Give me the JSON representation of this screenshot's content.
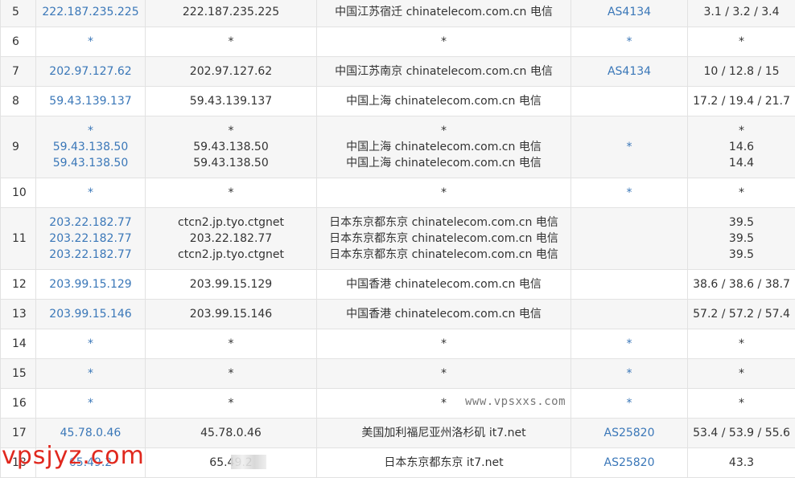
{
  "rows": [
    {
      "hop": "5",
      "ip": [
        "222.187.235.225"
      ],
      "host": [
        "222.187.235.225"
      ],
      "geo": [
        "中国江苏宿迁 chinatelecom.com.cn 电信"
      ],
      "as": [
        "AS4134"
      ],
      "latency": [
        "3.1 / 3.2 / 3.4"
      ]
    },
    {
      "hop": "6",
      "ip": [
        "*"
      ],
      "host": [
        "*"
      ],
      "geo": [
        "*"
      ],
      "as": [
        "*"
      ],
      "latency": [
        "*"
      ]
    },
    {
      "hop": "7",
      "ip": [
        "202.97.127.62"
      ],
      "host": [
        "202.97.127.62"
      ],
      "geo": [
        "中国江苏南京 chinatelecom.com.cn 电信"
      ],
      "as": [
        "AS4134"
      ],
      "latency": [
        "10 / 12.8 / 15"
      ]
    },
    {
      "hop": "8",
      "ip": [
        "59.43.139.137"
      ],
      "host": [
        "59.43.139.137"
      ],
      "geo": [
        "中国上海 chinatelecom.com.cn 电信"
      ],
      "as": [
        ""
      ],
      "latency": [
        "17.2 / 19.4 / 21.7"
      ]
    },
    {
      "hop": "9",
      "ip": [
        "*",
        "59.43.138.50",
        "59.43.138.50"
      ],
      "host": [
        "*",
        "59.43.138.50",
        "59.43.138.50"
      ],
      "geo": [
        "*",
        "中国上海 chinatelecom.com.cn 电信",
        "中国上海 chinatelecom.com.cn 电信"
      ],
      "as": [
        "*",
        "",
        ""
      ],
      "latency": [
        "*",
        "14.6",
        "14.4"
      ]
    },
    {
      "hop": "10",
      "ip": [
        "*"
      ],
      "host": [
        "*"
      ],
      "geo": [
        "*"
      ],
      "as": [
        "*"
      ],
      "latency": [
        "*"
      ]
    },
    {
      "hop": "11",
      "ip": [
        "203.22.182.77",
        "203.22.182.77",
        "203.22.182.77"
      ],
      "host": [
        "ctcn2.jp.tyo.ctgnet",
        "203.22.182.77",
        "ctcn2.jp.tyo.ctgnet"
      ],
      "geo": [
        "日本东京都东京 chinatelecom.com.cn 电信",
        "日本东京都东京 chinatelecom.com.cn 电信",
        "日本东京都东京 chinatelecom.com.cn 电信"
      ],
      "as": [
        "",
        "",
        ""
      ],
      "latency": [
        "39.5",
        "39.5",
        "39.5"
      ]
    },
    {
      "hop": "12",
      "ip": [
        "203.99.15.129"
      ],
      "host": [
        "203.99.15.129"
      ],
      "geo": [
        "中国香港 chinatelecom.com.cn 电信"
      ],
      "as": [
        ""
      ],
      "latency": [
        "38.6 / 38.6 / 38.7"
      ]
    },
    {
      "hop": "13",
      "ip": [
        "203.99.15.146"
      ],
      "host": [
        "203.99.15.146"
      ],
      "geo": [
        "中国香港 chinatelecom.com.cn 电信"
      ],
      "as": [
        ""
      ],
      "latency": [
        "57.2 / 57.2 / 57.4"
      ]
    },
    {
      "hop": "14",
      "ip": [
        "*"
      ],
      "host": [
        "*"
      ],
      "geo": [
        "*"
      ],
      "as": [
        "*"
      ],
      "latency": [
        "*"
      ]
    },
    {
      "hop": "15",
      "ip": [
        "*"
      ],
      "host": [
        "*"
      ],
      "geo": [
        "*"
      ],
      "as": [
        "*"
      ],
      "latency": [
        "*"
      ]
    },
    {
      "hop": "16",
      "ip": [
        "*"
      ],
      "host": [
        "*"
      ],
      "geo": [
        "*"
      ],
      "as": [
        "*"
      ],
      "latency": [
        "*"
      ]
    },
    {
      "hop": "17",
      "ip": [
        "45.78.0.46"
      ],
      "host": [
        "45.78.0.46"
      ],
      "geo": [
        "美国加利福尼亚州洛杉矶 it7.net"
      ],
      "as": [
        "AS25820"
      ],
      "latency": [
        "53.4 / 53.9 / 55.6"
      ]
    },
    {
      "hop": "18",
      "ip": [
        "65.49.2"
      ],
      "host": [
        "65.49.2"
      ],
      "geo": [
        "日本东京都东京 it7.net"
      ],
      "as": [
        "AS25820"
      ],
      "latency": [
        "43.3"
      ]
    }
  ],
  "watermarks": {
    "site": "www.vpsxxs.com",
    "brand": "vpsjyz.com"
  },
  "colors": {
    "link": "#3a77b8",
    "watermark_brand": "#e0281e"
  }
}
